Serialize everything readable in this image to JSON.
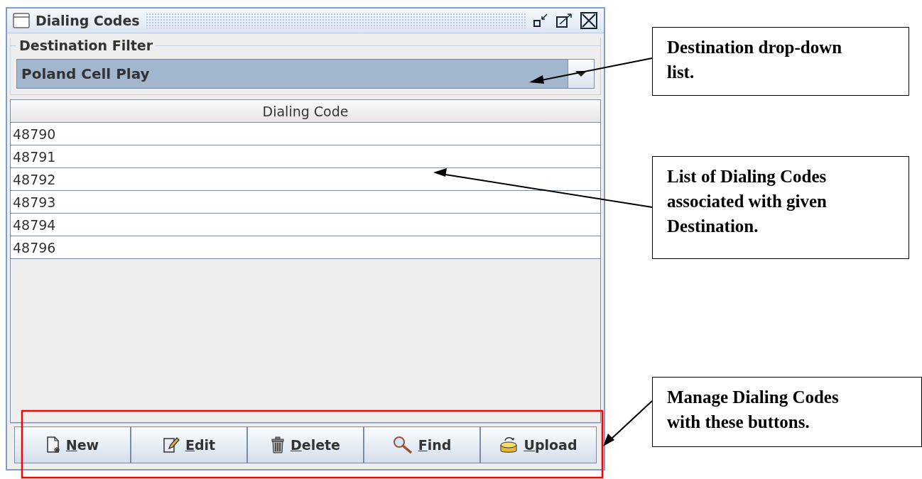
{
  "window": {
    "title": "Dialing Codes"
  },
  "destination_filter": {
    "label": "Destination Filter",
    "value": "Poland Cell Play"
  },
  "table": {
    "columns": [
      "Dialing Code"
    ],
    "rows": [
      {
        "cells": [
          "48790"
        ]
      },
      {
        "cells": [
          "48791"
        ]
      },
      {
        "cells": [
          "48792"
        ]
      },
      {
        "cells": [
          "48793"
        ]
      },
      {
        "cells": [
          "48794"
        ]
      },
      {
        "cells": [
          "48796"
        ]
      }
    ]
  },
  "buttons": [
    {
      "label": "New",
      "kind": "new"
    },
    {
      "label": "Edit",
      "kind": "edit"
    },
    {
      "label": "Delete",
      "kind": "delete"
    },
    {
      "label": "Find",
      "kind": "find"
    },
    {
      "label": "Upload",
      "kind": "upload"
    }
  ],
  "callouts": [
    {
      "lines": [
        "Destination drop-down",
        "list."
      ]
    },
    {
      "lines": [
        "List of Dialing Codes",
        "associated with given",
        "Destination."
      ]
    },
    {
      "lines": [
        "Manage Dialing Codes",
        "with these buttons."
      ]
    }
  ]
}
